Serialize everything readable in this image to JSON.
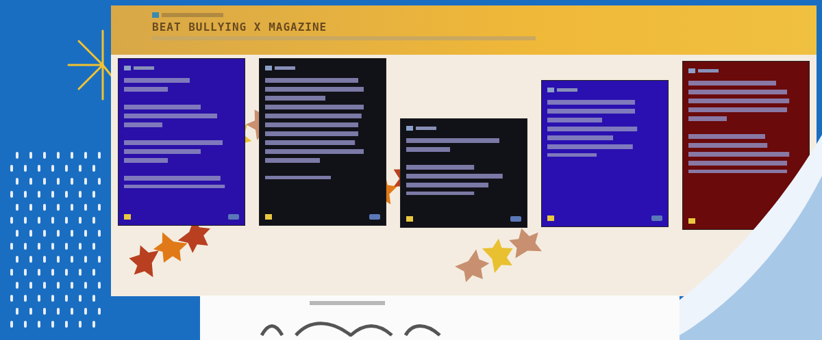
{
  "board": {
    "title": "BEAT BULLYING X MAGAZINE"
  },
  "posts": [
    {
      "color": "#2a10a8"
    },
    {
      "color": "#111118"
    },
    {
      "color": "#111118"
    },
    {
      "color": "#2a10b0"
    },
    {
      "color": "#6a0a0a"
    }
  ]
}
